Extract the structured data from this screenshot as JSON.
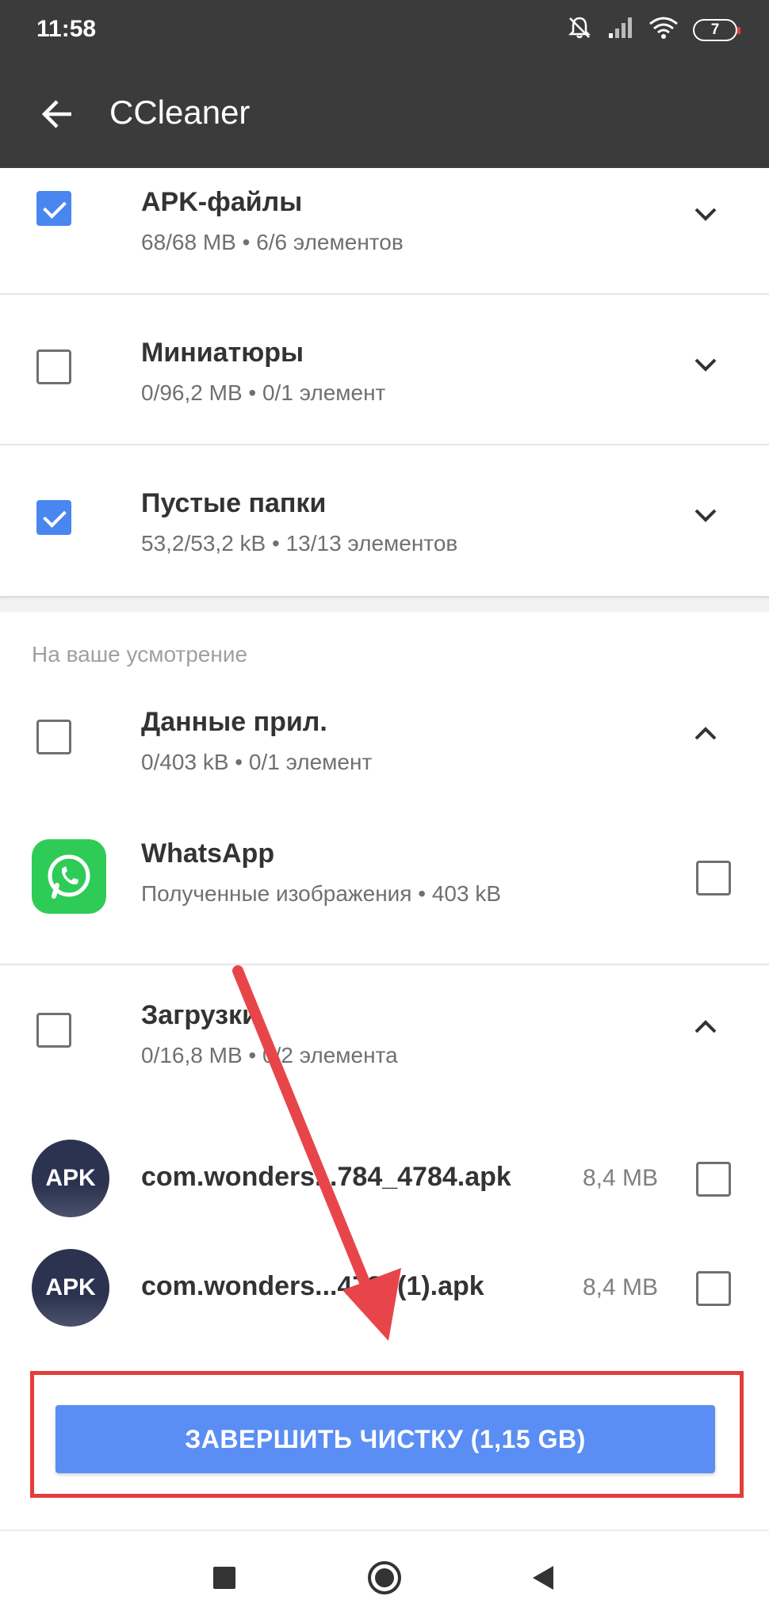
{
  "status": {
    "time": "11:58",
    "battery": "7",
    "icons": [
      "mute-icon",
      "signal-icon",
      "wifi-icon",
      "battery-icon"
    ]
  },
  "app_bar": {
    "title": "CCleaner",
    "back_icon": "arrow-back-icon"
  },
  "groups": [
    {
      "title": "APK-файлы",
      "subtitle": "68/68 MB • 6/6 элементов",
      "checked": true,
      "expanded": false
    },
    {
      "title": "Миниатюры",
      "subtitle": "0/96,2 MB • 0/1 элемент",
      "checked": false,
      "expanded": false
    },
    {
      "title": "Пустые папки",
      "subtitle": "53,2/53,2 kB • 13/13 элементов",
      "checked": true,
      "expanded": false
    }
  ],
  "optional_section": {
    "label": "На ваше усмотрение",
    "app_data": {
      "title": "Данные прил.",
      "subtitle": "0/403 kB • 0/1 элемент",
      "checked": false,
      "expanded": true,
      "items": [
        {
          "name": "WhatsApp",
          "detail": "Полученные изображения • 403 kB",
          "icon": "whatsapp-icon",
          "checked": false
        }
      ]
    },
    "downloads": {
      "title": "Загрузки",
      "subtitle": "0/16,8 MB • 0/2 элемента",
      "checked": false,
      "expanded": true,
      "items": [
        {
          "icon_label": "APK",
          "name": "com.wonders...784_4784.apk",
          "size": "8,4 MB",
          "checked": false
        },
        {
          "icon_label": "APK",
          "name": "com.wonders...4784(1).apk",
          "size": "8,4 MB",
          "checked": false
        }
      ]
    }
  },
  "finish_button": {
    "label": "ЗАВЕРШИТЬ ЧИСТКУ (1,15 GB)"
  },
  "annotation_colors": {
    "arrow": "#e8454a",
    "highlight": "#e53c3c"
  },
  "nav": {
    "icons": [
      "recents-square-icon",
      "home-circle-icon",
      "back-triangle-icon"
    ]
  }
}
